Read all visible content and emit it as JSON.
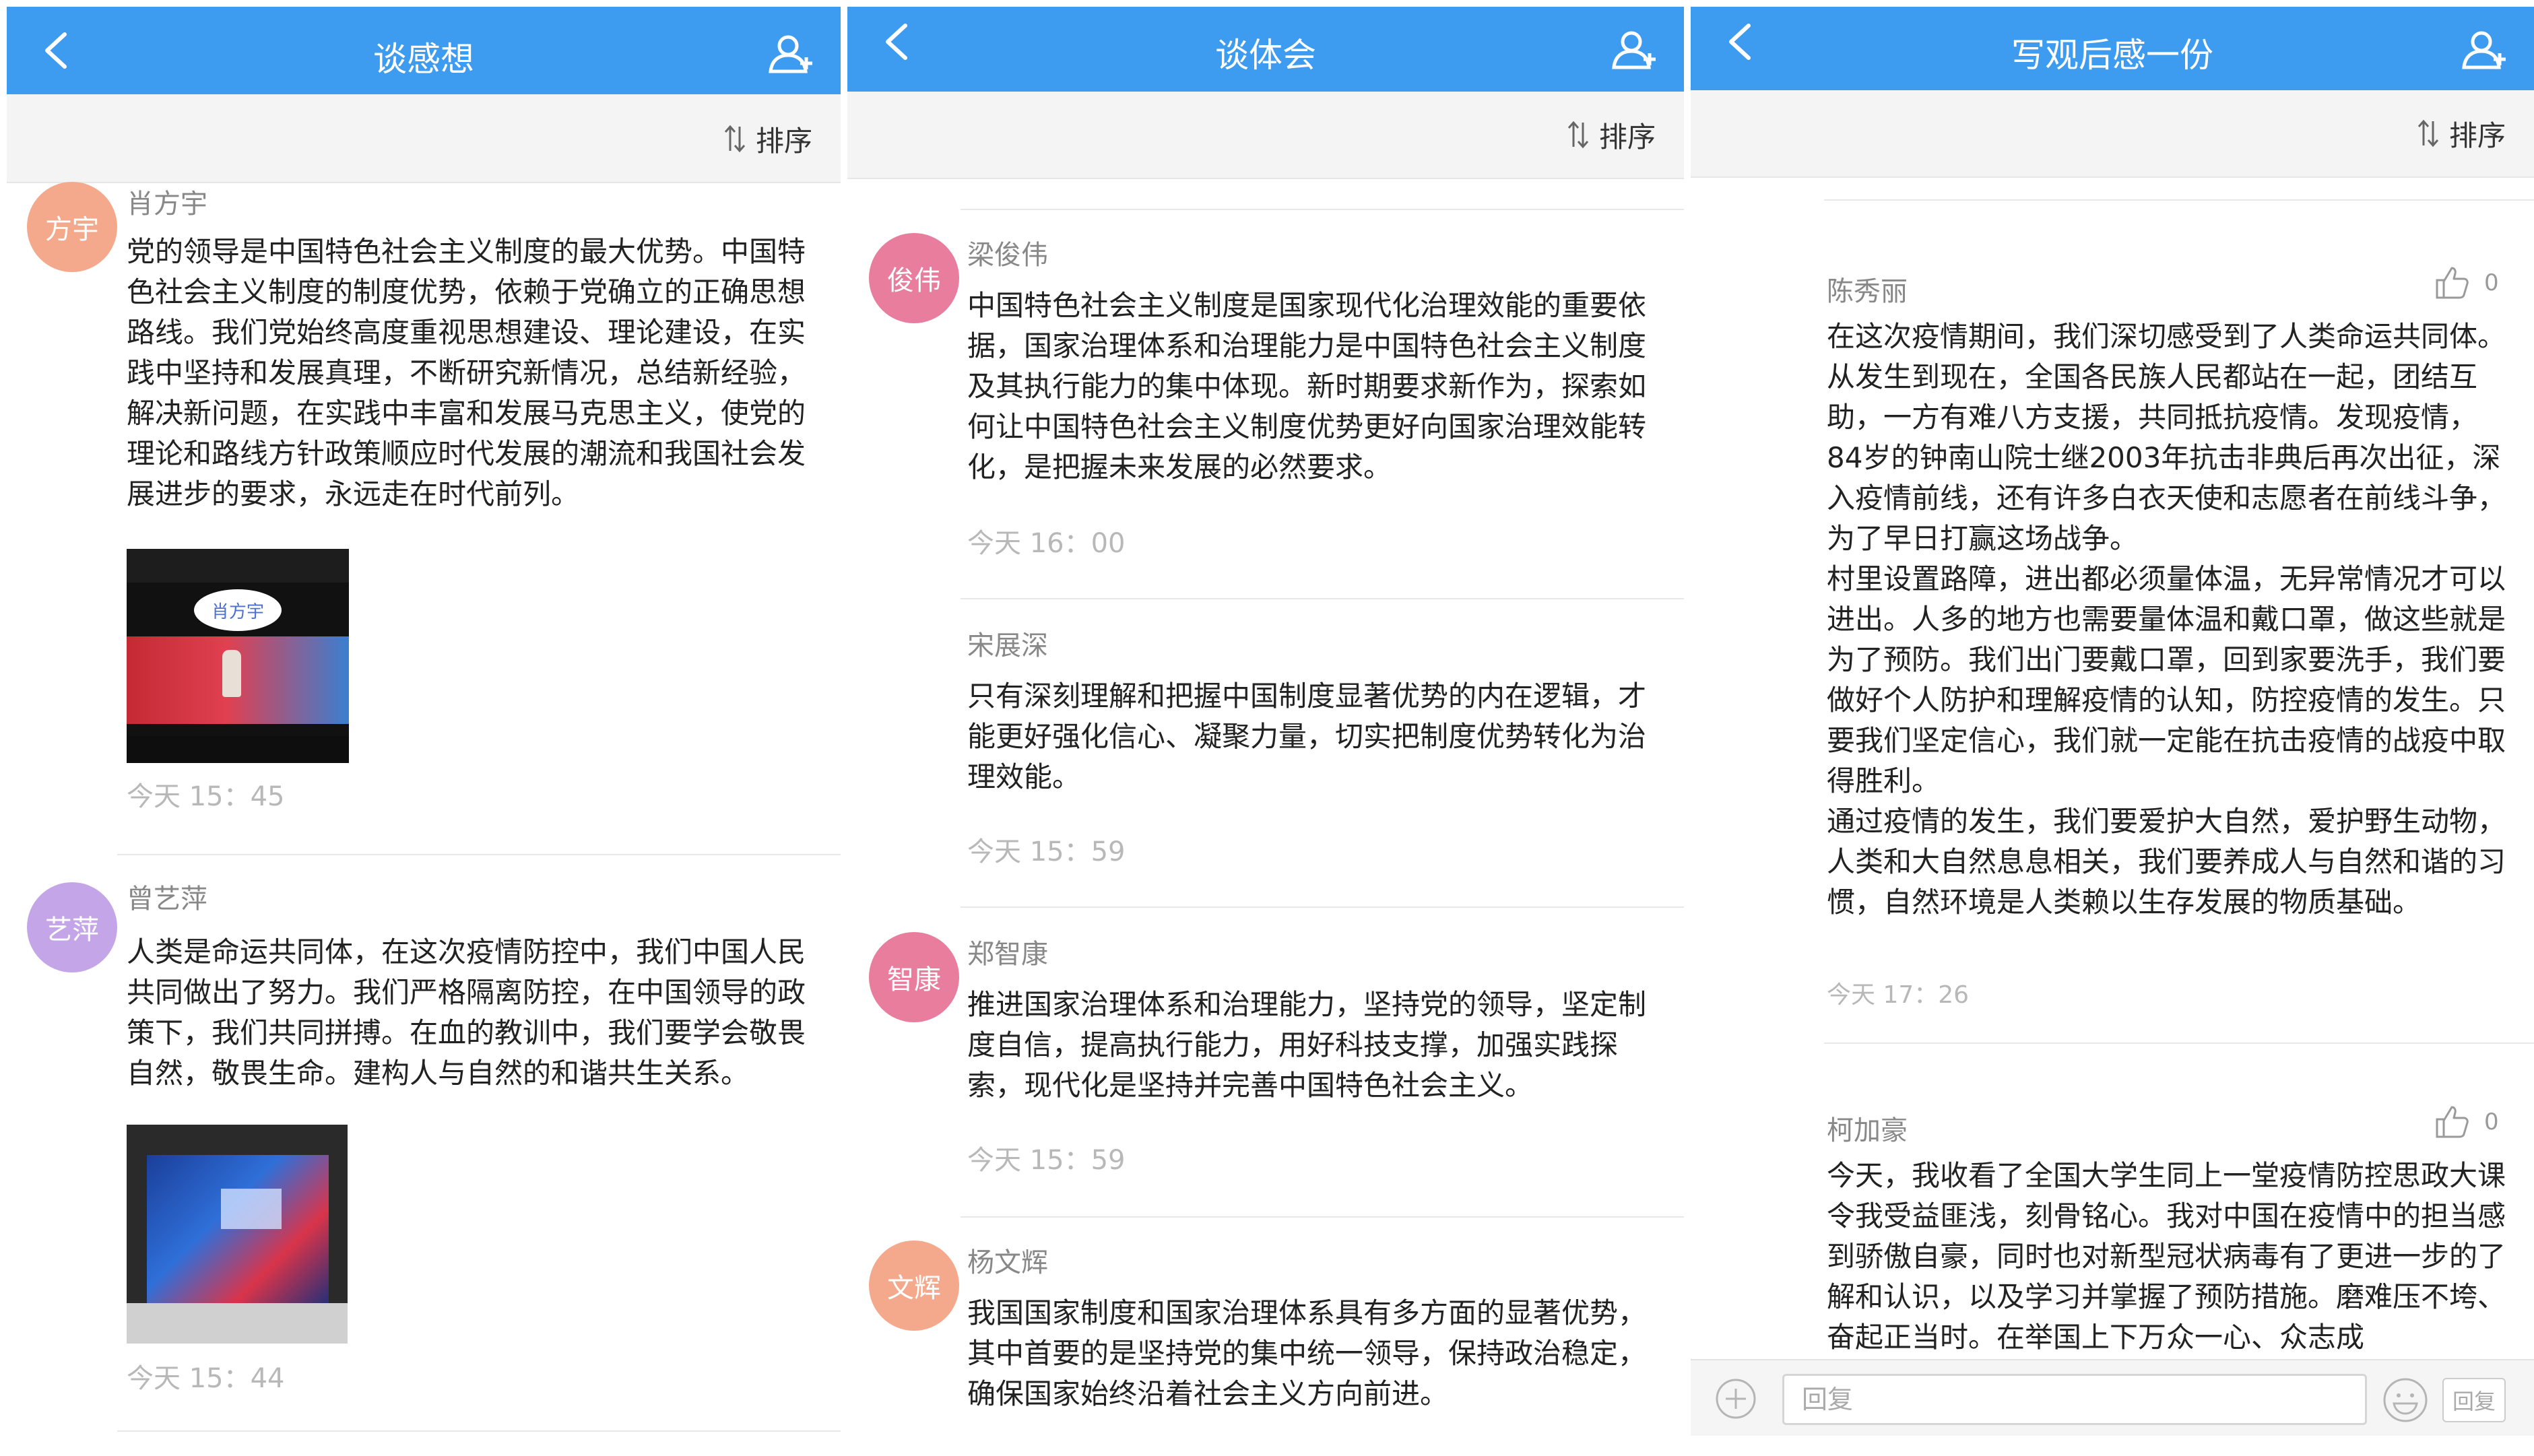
{
  "colors": {
    "accent": "#3d9bf0",
    "avatar_orange": "#f4a98c",
    "avatar_purple": "#c4a6e8",
    "avatar_pink": "#e87d9e"
  },
  "panels": [
    {
      "title": "谈感想",
      "sort_label": "排序",
      "comments": [
        {
          "avatar": "方宇",
          "name": "肖方宇",
          "text": "党的领导是中国特色社会主义制度的最大优势。中国特色社会主义制度的制度优势，依赖于党确立的正确思想路线。我们党始终高度重视思想建设、理论建设，在实践中坚持和发展真理，不断研究新情况，总结新经验，解决新问题，在实践中丰富和发展马克思主义，使党的理论和路线方针政策顺应时代发展的潮流和我国社会发展进步的要求，永远走在时代前列。",
          "image_caption": "肖方宇",
          "time": "今天 15：45"
        },
        {
          "avatar": "艺萍",
          "name": "曾艺萍",
          "text": "人类是命运共同体，在这次疫情防控中，我们中国人民共同做出了努力。我们严格隔离防控，在中国领导的政策下，我们共同拼搏。在血的教训中，我们要学会敬畏自然，敬畏生命。建构人与自然的和谐共生关系。",
          "time": "今天 15：44"
        }
      ]
    },
    {
      "title": "谈体会",
      "sort_label": "排序",
      "comments": [
        {
          "avatar": "俊伟",
          "name": "梁俊伟",
          "text": "中国特色社会主义制度是国家现代化治理效能的重要依据，国家治理体系和治理能力是中国特色社会主义制度及其执行能力的集中体现。新时期要求新作为，探索如何让中国特色社会主义制度优势更好向国家治理效能转化，是把握未来发展的必然要求。",
          "time": "今天 16：00"
        },
        {
          "name": "宋展深",
          "text": "只有深刻理解和把握中国制度显著优势的内在逻辑，才能更好强化信心、凝聚力量，切实把制度优势转化为治理效能。",
          "time": "今天 15：59"
        },
        {
          "avatar": "智康",
          "name": "郑智康",
          "text": "推进国家治理体系和治理能力，坚持党的领导，坚定制度自信，提高执行能力，用好科技支撑，加强实践探索，现代化是坚持并完善中国特色社会主义。",
          "time": "今天 15：59"
        },
        {
          "avatar": "文辉",
          "name": "杨文辉",
          "text": "我国国家制度和国家治理体系具有多方面的显著优势，其中首要的是坚持党的集中统一领导，保持政治稳定，确保国家始终沿着社会主义方向前进。"
        }
      ]
    },
    {
      "title": "写观后感一份",
      "sort_label": "排序",
      "comments": [
        {
          "name": "陈秀丽",
          "likes": "0",
          "paragraphs": [
            "在这次疫情期间，我们深切感受到了人类命运共同体。从发生到现在，全国各民族人民都站在一起，团结互助，一方有难八方支援，共同抵抗疫情。发现疫情，84岁的钟南山院士继2003年抗击非典后再次出征，深入疫情前线，还有许多白衣天使和志愿者在前线斗争，为了早日打赢这场战争。",
            "村里设置路障，进出都必须量体温，无异常情况才可以进出。人多的地方也需要量体温和戴口罩，做这些就是为了预防。我们出门要戴口罩，回到家要洗手，我们要做好个人防护和理解疫情的认知，防控疫情的发生。只要我们坚定信心，我们就一定能在抗击疫情的战疫中取得胜利。",
            "通过疫情的发生，我们要爱护大自然，爱护野生动物，人类和大自然息息相关，我们要养成人与自然和谐的习惯，自然环境是人类赖以生存发展的物质基础。"
          ],
          "time": "今天 17：26"
        },
        {
          "name": "柯加豪",
          "likes": "0",
          "text": "今天，我收看了全国大学生同上一堂疫情防控思政大课令我受益匪浅，刻骨铭心。我对中国在疫情中的担当感到骄傲自豪，同时也对新型冠状病毒有了更进一步的了解和认识，以及学习并掌握了预防措施。磨难压不垮、奋起正当时。在举国上下万众一心、众志成"
        }
      ],
      "reply": {
        "placeholder": "回复",
        "button": "回复"
      }
    }
  ]
}
